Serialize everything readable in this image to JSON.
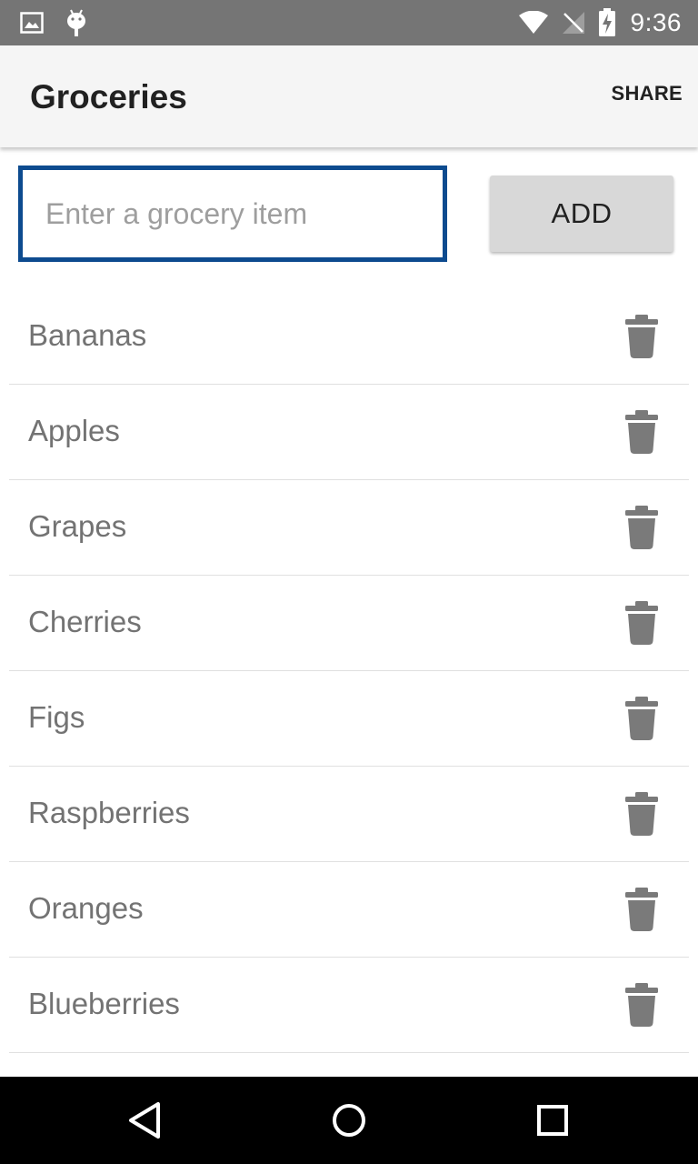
{
  "status_bar": {
    "time": "9:36",
    "left_icons": [
      "image-icon",
      "android-icon"
    ],
    "right_icons": [
      "wifi-icon",
      "no-signal-icon",
      "battery-charging-icon"
    ]
  },
  "app_bar": {
    "title": "Groceries",
    "share_label": "SHARE"
  },
  "input": {
    "value": "",
    "placeholder": "Enter a grocery item"
  },
  "add_button": {
    "label": "ADD"
  },
  "list": {
    "items": [
      {
        "label": "Bananas",
        "delete_icon": "trash-icon"
      },
      {
        "label": "Apples",
        "delete_icon": "trash-icon"
      },
      {
        "label": "Grapes",
        "delete_icon": "trash-icon"
      },
      {
        "label": "Cherries",
        "delete_icon": "trash-icon"
      },
      {
        "label": "Figs",
        "delete_icon": "trash-icon"
      },
      {
        "label": "Raspberries",
        "delete_icon": "trash-icon"
      },
      {
        "label": "Oranges",
        "delete_icon": "trash-icon"
      },
      {
        "label": "Blueberries",
        "delete_icon": "trash-icon"
      }
    ]
  },
  "nav_bar": {
    "buttons": [
      "back-icon",
      "home-icon",
      "recents-icon"
    ]
  },
  "colors": {
    "status_bar": "#757575",
    "app_bar": "#f5f5f5",
    "input_border": "#0d4b8f",
    "add_button": "#d8d8d8",
    "item_text": "#737373",
    "icon_gray": "#7a7a7a",
    "nav_bar": "#000000"
  }
}
